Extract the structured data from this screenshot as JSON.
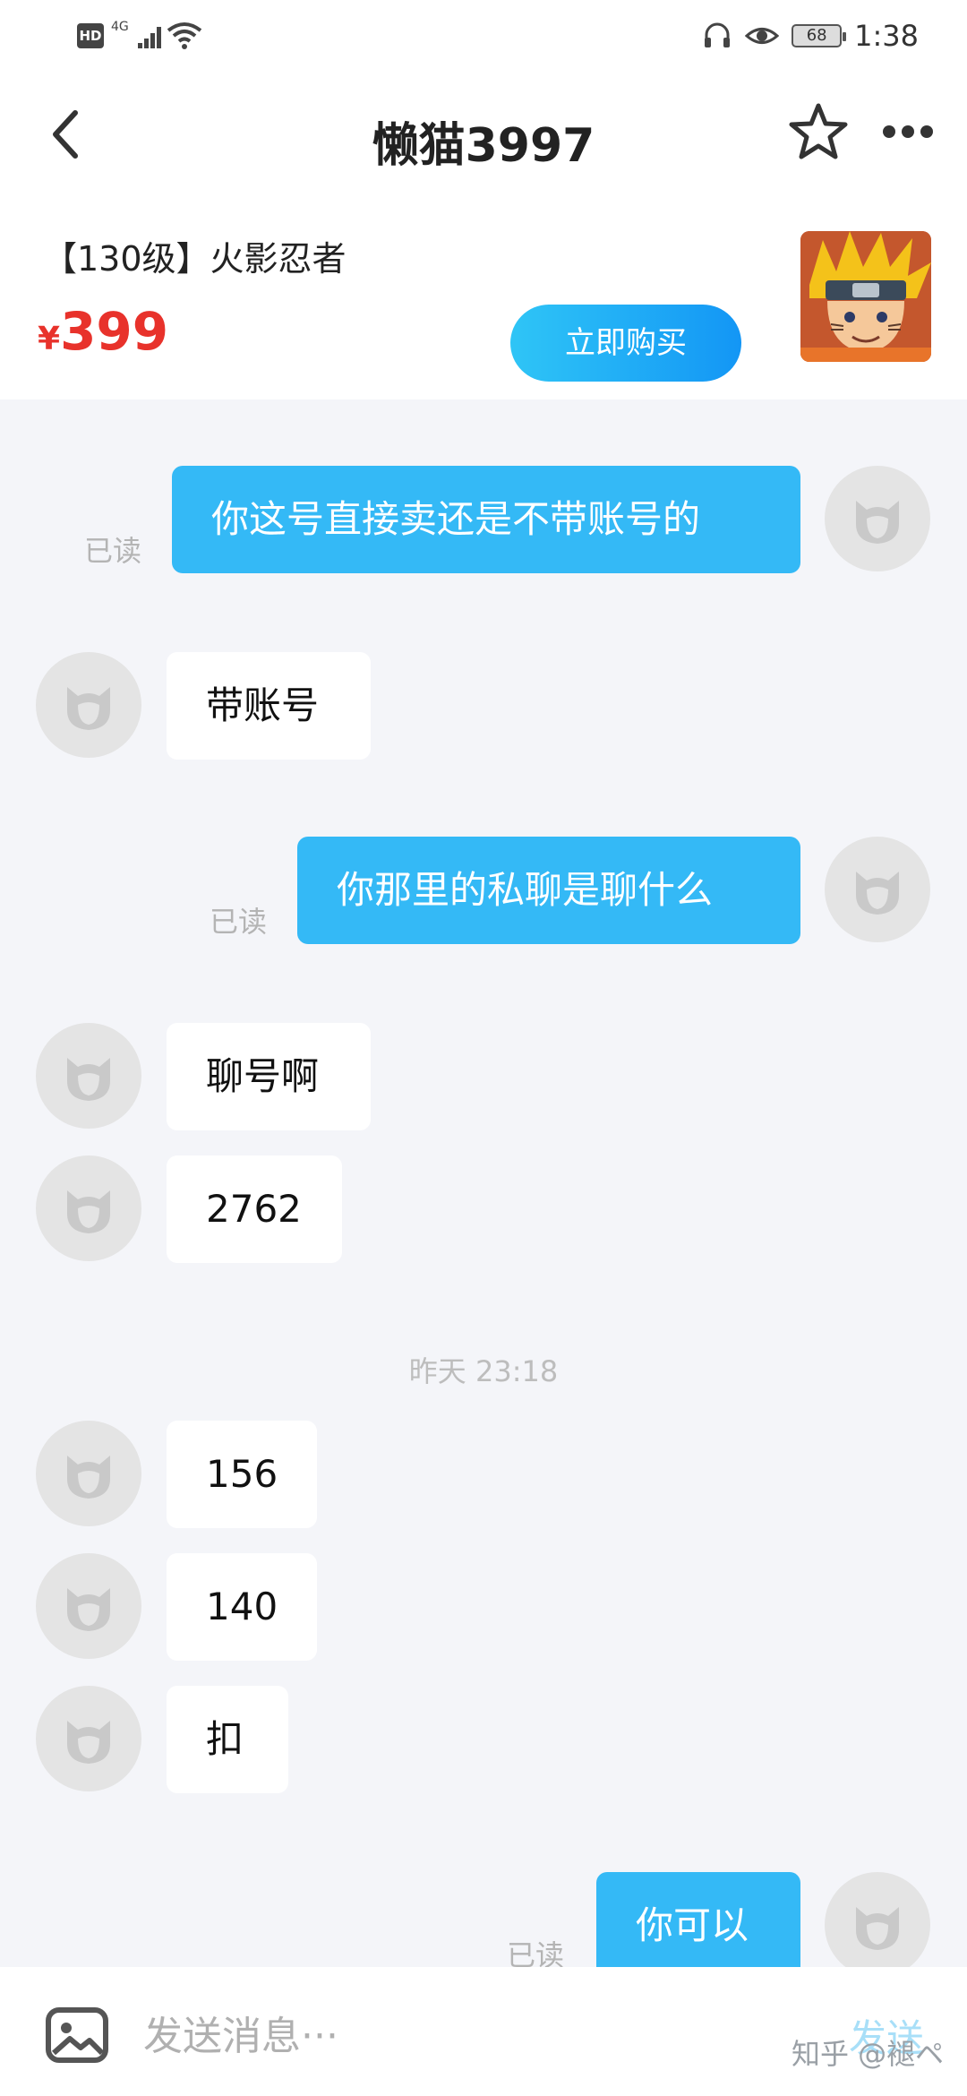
{
  "status_bar": {
    "hd": "HD",
    "network": "4G",
    "battery": "68",
    "time": "1:38"
  },
  "header": {
    "title": "懒猫3997"
  },
  "product": {
    "name": "【130级】火影忍者",
    "currency": "¥",
    "price": "399",
    "buy_label": "立即购买"
  },
  "messages": [
    {
      "side": "out",
      "text": "你这号直接卖还是不带账号的",
      "status": "已读"
    },
    {
      "side": "in",
      "text": "带账号"
    },
    {
      "side": "out",
      "text": "你那里的私聊是聊什么",
      "status": "已读"
    },
    {
      "side": "in",
      "text": "聊号啊"
    },
    {
      "side": "in",
      "text": "2762"
    },
    {
      "timestamp": "昨天 23:18"
    },
    {
      "side": "in",
      "text": "156"
    },
    {
      "side": "in",
      "text": "140"
    },
    {
      "side": "in",
      "text": "扣"
    },
    {
      "side": "out",
      "text": "你可以",
      "status": "已读"
    }
  ],
  "composer": {
    "placeholder": "发送消息···",
    "send_label": "发送"
  },
  "watermark": "知乎 @褪ペ",
  "colors": {
    "outgoing_bubble": "#34b9f6",
    "price": "#e8322b",
    "buy_button": "#1aa6f6"
  }
}
